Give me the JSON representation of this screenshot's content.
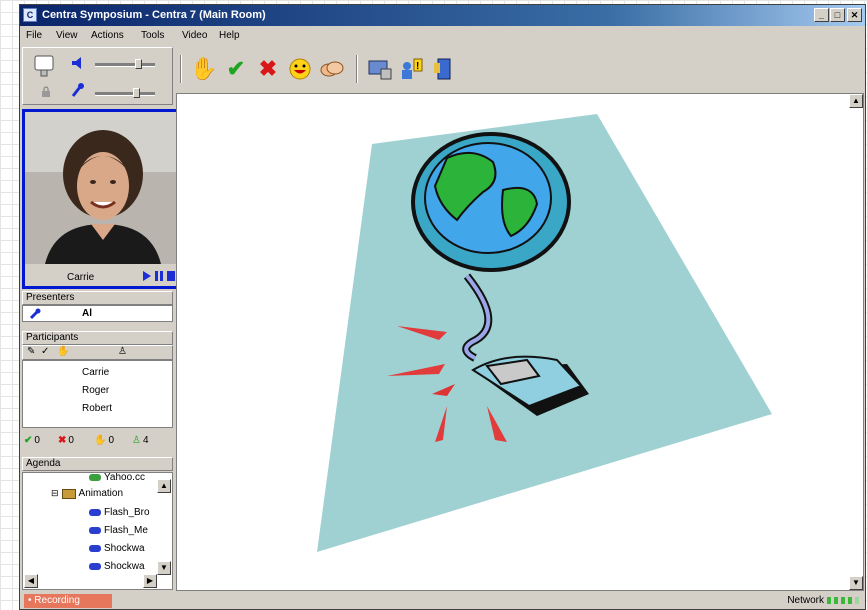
{
  "window": {
    "title": "Centra Symposium - Centra 7 (Main Room)"
  },
  "menu": [
    "File",
    "View",
    "Actions",
    "Tools",
    "Video",
    "Help"
  ],
  "toolbar": {
    "buttons": [
      "raise-hand",
      "yes-checkmark",
      "no-x",
      "laugh",
      "applause"
    ],
    "tools": [
      "computer-settings",
      "alert-people",
      "exit-door"
    ]
  },
  "video": {
    "name": "Carrie"
  },
  "presenters": {
    "header": "Presenters",
    "name": "Al"
  },
  "participants": {
    "header": "Participants",
    "names": [
      "Carrie",
      "Roger",
      "Robert"
    ]
  },
  "stats": {
    "yes": "0",
    "no": "0",
    "hand": "0",
    "people": "4"
  },
  "agenda": {
    "header": "Agenda",
    "items": [
      "Yahoo.cc",
      "Animation",
      "Flash_Bro",
      "Flash_Me",
      "Shockwa",
      "Shockwa"
    ]
  },
  "status": {
    "recording": "Recording",
    "network": "Network"
  },
  "colors": {
    "title_start": "#0a246a",
    "accent_border": "#0018d0",
    "recording_bg": "#e6765c",
    "network_green": "#3bb83b"
  }
}
